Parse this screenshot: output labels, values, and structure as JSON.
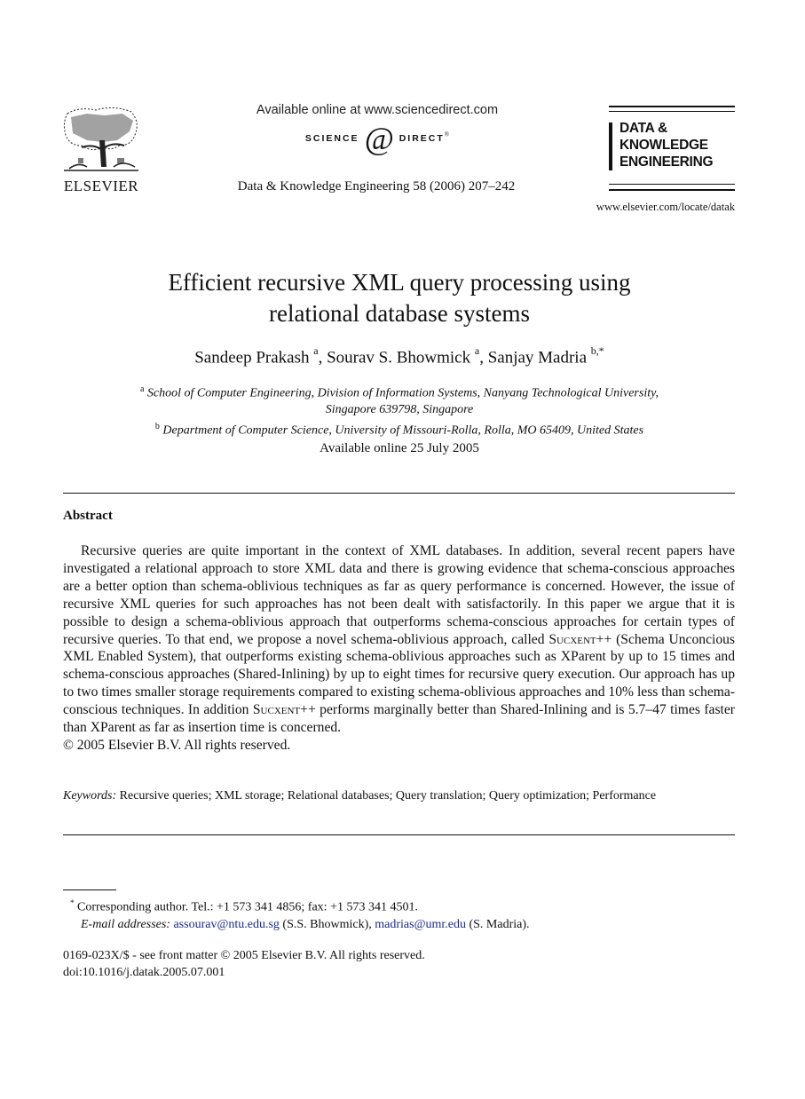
{
  "header": {
    "publisher_name": "ELSEVIER",
    "available_online_at": "Available online at www.sciencedirect.com",
    "sciencedirect_logo": {
      "left_word": "SCIENCE",
      "at_symbol": "d",
      "right_word": "DIRECT",
      "registered": "®"
    },
    "journal_citation": "Data & Knowledge Engineering 58 (2006) 207–242",
    "journal_logo_lines": [
      "DATA &",
      "KNOWLEDGE",
      "ENGINEERING"
    ],
    "journal_url": "www.elsevier.com/locate/datak"
  },
  "article": {
    "title_line1": "Efficient recursive XML query processing using",
    "title_line2": "relational database systems",
    "authors": [
      {
        "name": "Sandeep Prakash",
        "affil": "a"
      },
      {
        "name": "Sourav S. Bhowmick",
        "affil": "a"
      },
      {
        "name": "Sanjay Madria",
        "affil": "b,*"
      }
    ],
    "author_separator": ", ",
    "affiliations": [
      {
        "mark": "a",
        "line1": "School of Computer Engineering, Division of Information Systems, Nanyang Technological University,",
        "line2": "Singapore 639798, Singapore"
      },
      {
        "mark": "b",
        "line1": "Department of Computer Science, University of Missouri-Rolla, Rolla, MO 65409, United States"
      }
    ],
    "available_online": "Available online 25 July 2005"
  },
  "abstract": {
    "heading": "Abstract",
    "text_part1": "Recursive queries are quite important in the context of XML databases. In addition, several recent papers have investigated a relational approach to store XML data and there is growing evidence that schema-conscious approaches are a better option than schema-oblivious techniques as far as query performance is concerned. However, the issue of recursive XML queries for such approaches has not been dealt with satisfactorily. In this paper we argue that it is possible to design a schema-oblivious approach that outperforms schema-conscious approaches for certain types of recursive queries. To that end, we propose a novel schema-oblivious approach, called ",
    "system_name": "Sucxent++",
    "text_part2": " (Schema Unconcious XML Enabled System), that outperforms existing schema-oblivious approaches such as XParent by up to 15 times and schema-conscious approaches (Shared-Inlining) by up to eight times for recursive query execution. Our approach has up to two times smaller storage requirements compared to existing schema-oblivious approaches and 10% less than schema-conscious techniques. In addition ",
    "text_part3": " performs marginally better than Shared-Inlining and is 5.7–47 times faster than XParent as far as insertion time is concerned.",
    "copyright": "© 2005 Elsevier B.V. All rights reserved."
  },
  "keywords": {
    "label": "Keywords:",
    "text": " Recursive queries; XML storage; Relational databases; Query translation; Query optimization; Performance"
  },
  "footnote": {
    "mark": "*",
    "corresponding": " Corresponding author. Tel.: +1 573 341 4856; fax: +1 573 341 4501.",
    "email_label": "E-mail addresses:",
    "email1": "assourav@ntu.edu.sg",
    "email1_owner": " (S.S. Bhowmick), ",
    "email2": "madrias@umr.edu",
    "email2_owner": " (S. Madria)."
  },
  "front_matter": {
    "issn_line": "0169-023X/$ - see front matter  © 2005 Elsevier B.V. All rights reserved.",
    "doi": "doi:10.1016/j.datak.2005.07.001"
  },
  "colors": {
    "text": "#111111",
    "email_link": "#1a2a8c",
    "background": "#ffffff"
  }
}
